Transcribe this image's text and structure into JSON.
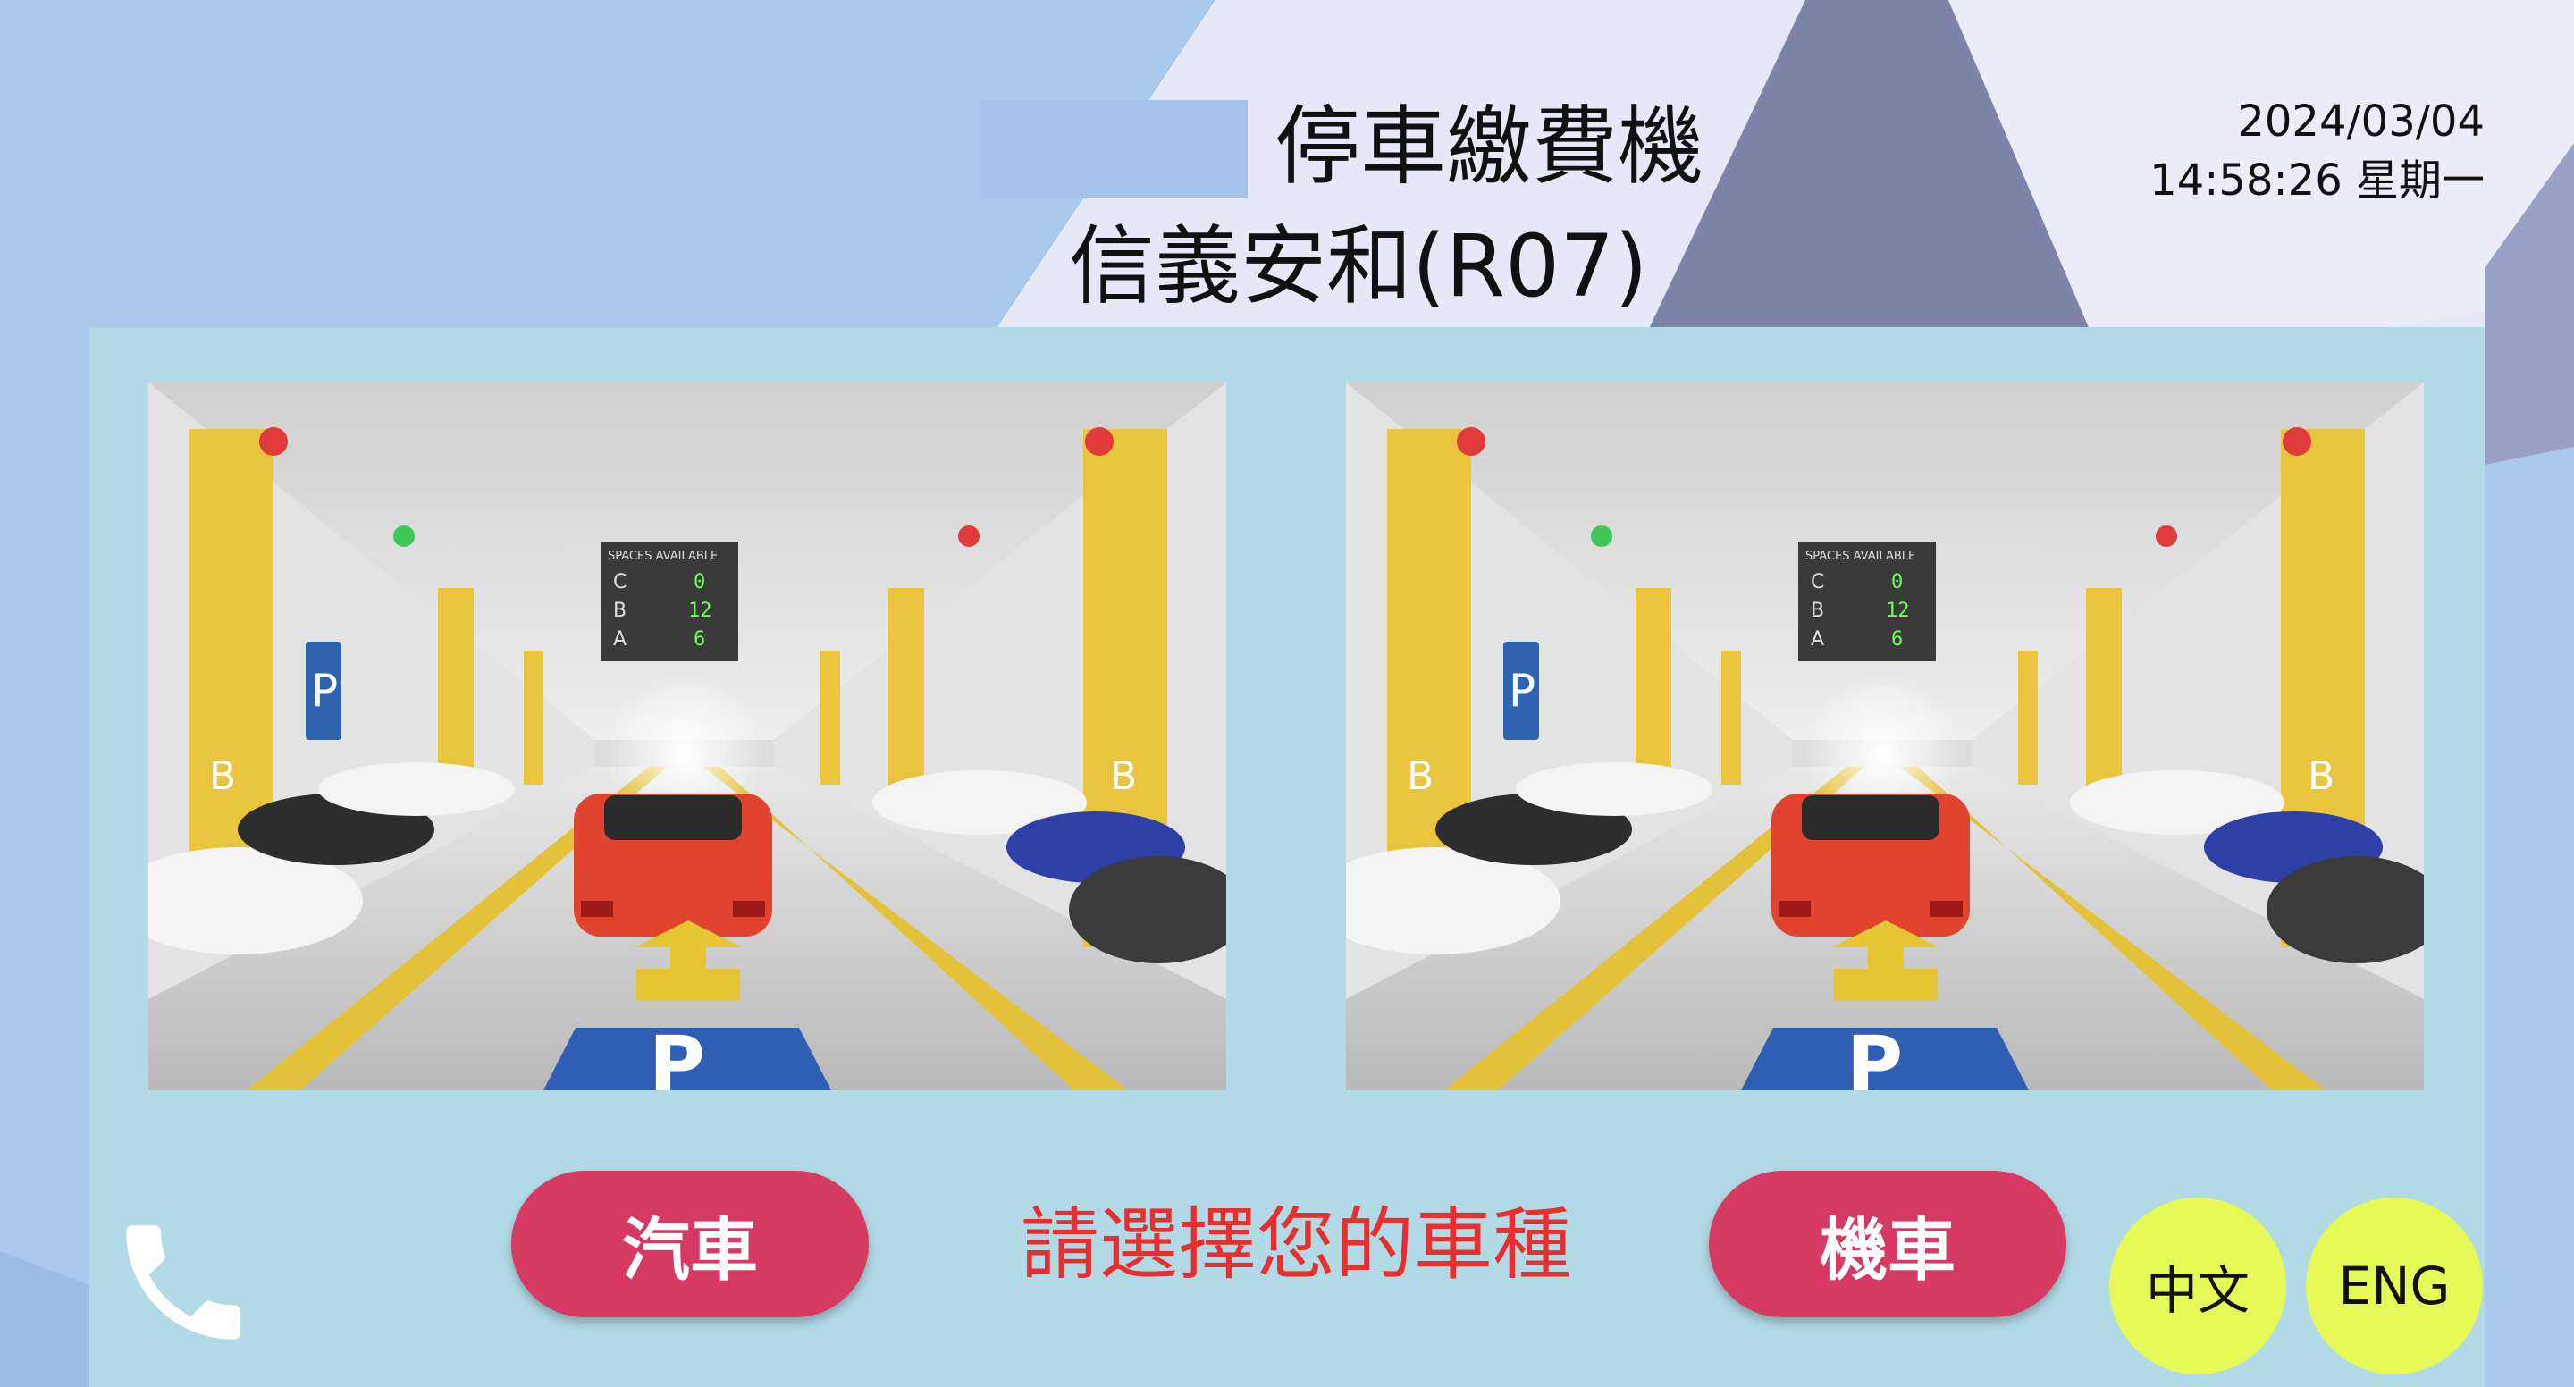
{
  "header": {
    "title": "停車繳費機",
    "station": "信義安和(R07)",
    "date": "2024/03/04",
    "time": "14:58:26 星期一"
  },
  "scene_sign": {
    "heading": "SPACES AVAILABLE",
    "rows": [
      {
        "level": "C",
        "count": "0"
      },
      {
        "level": "B",
        "count": "12"
      },
      {
        "level": "A",
        "count": "6"
      }
    ],
    "pillar_letter": "B",
    "parking_letter": "P"
  },
  "vehicle_select": {
    "car_label": "汽車",
    "motorcycle_label": "機車",
    "prompt": "請選擇您的車種"
  },
  "language": {
    "chinese_label": "中文",
    "english_label": "ENG"
  },
  "icons": {
    "call": "phone-icon"
  },
  "colors": {
    "panel": "#b2d9e6",
    "vehicle_button": "#d63a62",
    "prompt_text": "#e53030",
    "language_button": "#e5f957"
  }
}
